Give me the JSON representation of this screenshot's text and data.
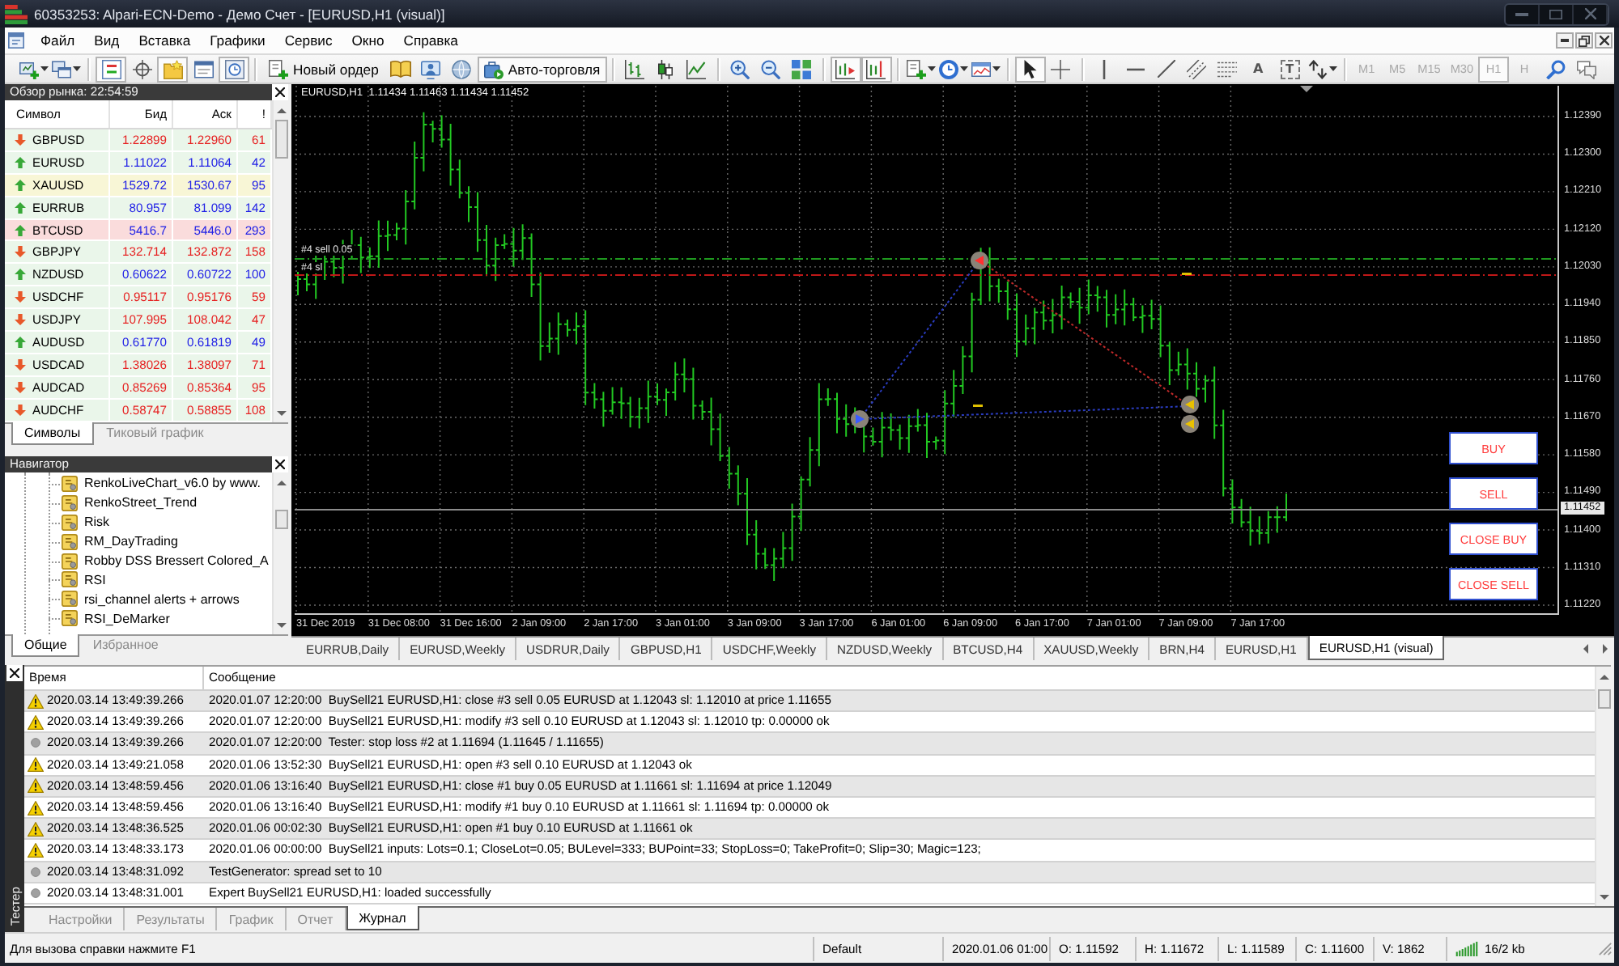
{
  "window": {
    "title": "60353253: Alpari-ECN-Demo - Демо Счет - [EURUSD,H1 (visual)]"
  },
  "menu": [
    "Файл",
    "Вид",
    "Вставка",
    "Графики",
    "Сервис",
    "Окно",
    "Справка"
  ],
  "toolbar": [
    [
      {
        "kind": "icon",
        "pressed": false,
        "dropdown": true
      },
      {
        "kind": "icon",
        "pressed": false,
        "dropdown": true
      }
    ],
    [
      {
        "kind": "icon",
        "pressed": true
      },
      {
        "kind": "icon",
        "pressed": false
      },
      {
        "kind": "icon",
        "pressed": true
      },
      {
        "kind": "icon",
        "pressed": false
      },
      {
        "kind": "icon",
        "pressed": true
      }
    ],
    [
      {
        "kind": "labeled",
        "label": "Новый ордер",
        "pressed": false
      },
      {
        "kind": "icon",
        "pressed": false
      },
      {
        "kind": "icon",
        "pressed": false
      },
      {
        "kind": "icon",
        "pressed": false
      },
      {
        "kind": "labeled",
        "label": "Авто-торговля",
        "pressed": true
      }
    ],
    [
      {
        "kind": "icon",
        "pressed": false
      },
      {
        "kind": "icon",
        "pressed": false
      },
      {
        "kind": "icon",
        "pressed": false
      }
    ],
    [
      {
        "kind": "icon",
        "pressed": false
      },
      {
        "kind": "icon",
        "pressed": false
      },
      {
        "kind": "icon",
        "pressed": false
      }
    ],
    [
      {
        "kind": "icon",
        "pressed": true
      },
      {
        "kind": "icon",
        "pressed": true
      }
    ],
    [
      {
        "kind": "icon",
        "pressed": false,
        "dropdown": true
      },
      {
        "kind": "icon",
        "pressed": false,
        "dropdown": true
      },
      {
        "kind": "icon",
        "pressed": false,
        "dropdown": true
      }
    ],
    [
      {
        "kind": "icon",
        "pressed": true
      },
      {
        "kind": "icon",
        "pressed": false
      }
    ],
    [
      {
        "kind": "icon",
        "pressed": false
      },
      {
        "kind": "icon",
        "pressed": false
      },
      {
        "kind": "icon",
        "pressed": false
      },
      {
        "kind": "icon",
        "pressed": false
      },
      {
        "kind": "icon",
        "pressed": false
      },
      {
        "kind": "glyph",
        "text": "A",
        "framed": false,
        "pressed": false
      },
      {
        "kind": "glyph",
        "text": "T",
        "framed": true,
        "pressed": false
      },
      {
        "kind": "icon",
        "pressed": false,
        "dropdown": true
      }
    ],
    [
      {
        "kind": "timeframe",
        "label": "M1",
        "selected": false,
        "disabled": true
      },
      {
        "kind": "timeframe",
        "label": "M5",
        "selected": false,
        "disabled": true
      },
      {
        "kind": "timeframe",
        "label": "M15",
        "selected": false,
        "disabled": true
      },
      {
        "kind": "timeframe",
        "label": "M30",
        "selected": false,
        "disabled": true
      },
      {
        "kind": "timeframe",
        "label": "H1",
        "selected": true,
        "disabled": true
      },
      {
        "kind": "timeframe",
        "label": "H",
        "selected": false,
        "disabled": true
      },
      {
        "kind": "icon",
        "pressed": false
      },
      {
        "kind": "icon",
        "pressed": false
      }
    ]
  ],
  "market_watch": {
    "title": "Обзор рынка: 22:54:59",
    "columns": [
      "Символ",
      "Бид",
      "Аск",
      "!"
    ],
    "rows": [
      {
        "symbol": "GBPUSD",
        "rising": false,
        "bid": "1.22899",
        "ask": "1.22960",
        "spread": "61",
        "color": "#eaf6ea"
      },
      {
        "symbol": "EURUSD",
        "rising": true,
        "bid": "1.11022",
        "ask": "1.11064",
        "spread": "42",
        "color": "#eaf6ea"
      },
      {
        "symbol": "XAUUSD",
        "rising": true,
        "bid": "1529.72",
        "ask": "1530.67",
        "spread": "95",
        "color": "#f8f6d6"
      },
      {
        "symbol": "EURRUB",
        "rising": true,
        "bid": "80.957",
        "ask": "81.099",
        "spread": "142",
        "color": "#eaf6ea"
      },
      {
        "symbol": "BTCUSD",
        "rising": true,
        "bid": "5416.7",
        "ask": "5446.0",
        "spread": "293",
        "color": "#fadcdc"
      },
      {
        "symbol": "GBPJPY",
        "rising": false,
        "bid": "132.714",
        "ask": "132.872",
        "spread": "158",
        "color": "#eaf6ea"
      },
      {
        "symbol": "NZDUSD",
        "rising": true,
        "bid": "0.60622",
        "ask": "0.60722",
        "spread": "100",
        "color": "#eaf6ea"
      },
      {
        "symbol": "USDCHF",
        "rising": false,
        "bid": "0.95117",
        "ask": "0.95176",
        "spread": "59",
        "color": "#eaf6ea"
      },
      {
        "symbol": "USDJPY",
        "rising": false,
        "bid": "107.995",
        "ask": "108.042",
        "spread": "47",
        "color": "#eaf6ea"
      },
      {
        "symbol": "AUDUSD",
        "rising": true,
        "bid": "0.61770",
        "ask": "0.61819",
        "spread": "49",
        "color": "#eaf6ea"
      },
      {
        "symbol": "USDCAD",
        "rising": false,
        "bid": "1.38026",
        "ask": "1.38097",
        "spread": "71",
        "color": "#eaf6ea"
      },
      {
        "symbol": "AUDCAD",
        "rising": false,
        "bid": "0.85269",
        "ask": "0.85364",
        "spread": "95",
        "color": "#eaf6ea"
      },
      {
        "symbol": "AUDCHF",
        "rising": false,
        "bid": "0.58747",
        "ask": "0.58855",
        "spread": "108",
        "color": "#eaf6ea"
      }
    ],
    "tabs": [
      {
        "label": "Символы",
        "selected": true
      },
      {
        "label": "Тиковый график",
        "selected": false
      }
    ]
  },
  "navigator": {
    "title": "Навигатор",
    "items": [
      "RenkoLiveChart_v6.0 by www.",
      "RenkoStreet_Trend",
      "Risk",
      "RM_DayTrading",
      "Robby DSS Bressert Colored_A",
      "RSI",
      "rsi_channel alerts + arrows",
      "RSI_DeMarker"
    ],
    "tabs": [
      {
        "label": "Общие",
        "selected": true
      },
      {
        "label": "Избранное",
        "selected": false
      }
    ]
  },
  "chart": {
    "title": "EURUSD,H1  1.11434 1.11463 1.11434 1.11452",
    "price_labels": [
      "1.12390",
      "1.12300",
      "1.12210",
      "1.12120",
      "1.12030",
      "1.11940",
      "1.11850",
      "1.11760",
      "1.11670",
      "1.11580",
      "1.11490",
      "1.11400",
      "1.11310",
      "1.11220"
    ],
    "current_price": "1.11452",
    "time_labels": [
      "31 Dec 2019",
      "31 Dec 08:00",
      "31 Dec 16:00",
      "2 Jan 09:00",
      "2 Jan 17:00",
      "3 Jan 01:00",
      "3 Jan 09:00",
      "3 Jan 17:00",
      "6 Jan 01:00",
      "6 Jan 09:00",
      "6 Jan 17:00",
      "7 Jan 01:00",
      "7 Jan 09:00",
      "7 Jan 17:00"
    ],
    "order_labels": [
      "#4 sell 0.05",
      "#4 sl"
    ],
    "buttons": [
      "BUY",
      "SELL",
      "CLOSE BUY",
      "CLOSE SELL"
    ]
  },
  "chart_tabs": [
    {
      "label": "EURRUB,Daily",
      "selected": false
    },
    {
      "label": "EURUSD,Weekly",
      "selected": false
    },
    {
      "label": "USDRUR,Daily",
      "selected": false
    },
    {
      "label": "GBPUSD,H1",
      "selected": false
    },
    {
      "label": "USDCHF,Weekly",
      "selected": false
    },
    {
      "label": "NZDUSD,Weekly",
      "selected": false
    },
    {
      "label": "BTCUSD,H4",
      "selected": false
    },
    {
      "label": "XAUUSD,Weekly",
      "selected": false
    },
    {
      "label": "BRN,H4",
      "selected": false
    },
    {
      "label": "EURUSD,H1",
      "selected": false
    },
    {
      "label": "EURUSD,H1 (visual)",
      "selected": true
    }
  ],
  "terminal": {
    "title": "Тестер",
    "columns": [
      "Время",
      "Сообщение"
    ],
    "rows": [
      {
        "kind": "warning",
        "time": "2020.03.14 13:49:39.266",
        "message": "2020.01.07 12:20:00  BuySell21 EURUSD,H1: close #3 sell 0.05 EURUSD at 1.12043 sl: 1.12010 at price 1.11655"
      },
      {
        "kind": "warning",
        "time": "2020.03.14 13:49:39.266",
        "message": "2020.01.07 12:20:00  BuySell21 EURUSD,H1: modify #3 sell 0.10 EURUSD at 1.12043 sl: 1.12010 tp: 0.00000 ok"
      },
      {
        "kind": "info",
        "time": "2020.03.14 13:49:39.266",
        "message": "2020.01.07 12:20:00  Tester: stop loss #2 at 1.11694 (1.11645 / 1.11655)"
      },
      {
        "kind": "warning",
        "time": "2020.03.14 13:49:21.058",
        "message": "2020.01.06 13:52:30  BuySell21 EURUSD,H1: open #3 sell 0.10 EURUSD at 1.12043 ok"
      },
      {
        "kind": "warning",
        "time": "2020.03.14 13:48:59.456",
        "message": "2020.01.06 13:16:40  BuySell21 EURUSD,H1: close #1 buy 0.05 EURUSD at 1.11661 sl: 1.11694 at price 1.12049"
      },
      {
        "kind": "warning",
        "time": "2020.03.14 13:48:59.456",
        "message": "2020.01.06 13:16:40  BuySell21 EURUSD,H1: modify #1 buy 0.10 EURUSD at 1.11661 sl: 1.11694 tp: 0.00000 ok"
      },
      {
        "kind": "warning",
        "time": "2020.03.14 13:48:36.525",
        "message": "2020.01.06 00:02:30  BuySell21 EURUSD,H1: open #1 buy 0.10 EURUSD at 1.11661 ok"
      },
      {
        "kind": "warning",
        "time": "2020.03.14 13:48:33.173",
        "message": "2020.01.06 00:00:00  BuySell21 inputs: Lots=0.1; CloseLot=0.05; BULevel=333; BUPoint=33; StopLoss=0; TakeProfit=0; Slip=30; Magic=123;"
      },
      {
        "kind": "info",
        "time": "2020.03.14 13:48:31.092",
        "message": "TestGenerator: spread set to 10"
      },
      {
        "kind": "info",
        "time": "2020.03.14 13:48:31.001",
        "message": "Expert BuySell21 EURUSD,H1: loaded successfully"
      }
    ],
    "tabs": [
      {
        "label": "Настройки",
        "selected": false
      },
      {
        "label": "Результаты",
        "selected": false
      },
      {
        "label": "График",
        "selected": false
      },
      {
        "label": "Отчет",
        "selected": false
      },
      {
        "label": "Журнал",
        "selected": true
      }
    ]
  },
  "status_bar": {
    "help": "Для вызова справки нажмите F1",
    "profile": "Default",
    "bar_time": "2020.01.06 01:00",
    "open": "O: 1.11592",
    "high": "H: 1.11672",
    "low": "L: 1.11589",
    "close": "C: 1.11600",
    "volume": "V: 1862",
    "traffic": "16/2 kb"
  }
}
